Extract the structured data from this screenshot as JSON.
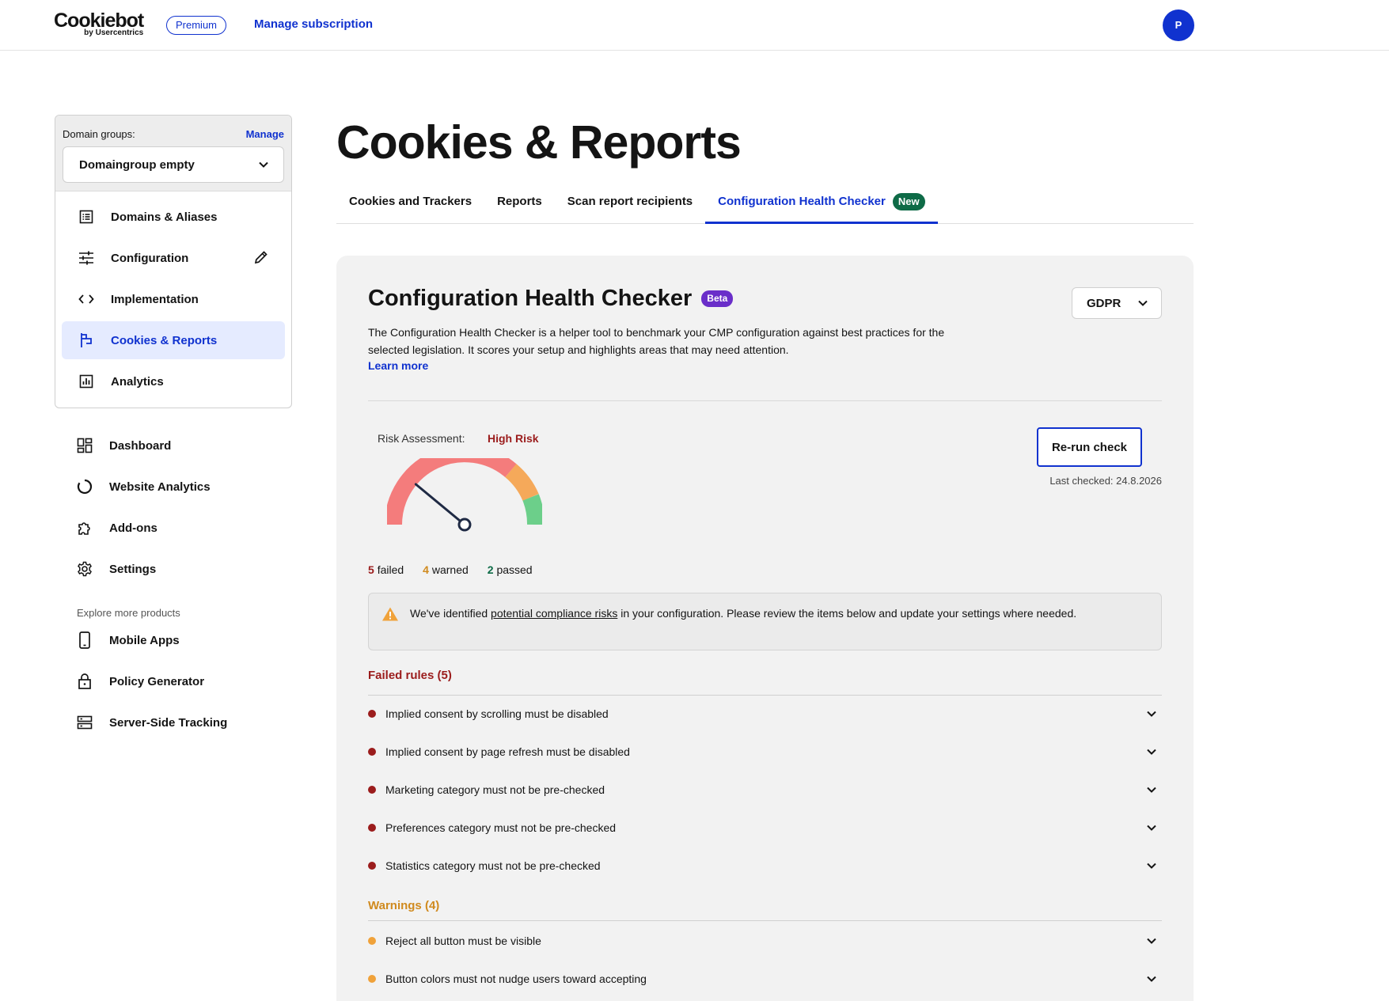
{
  "topbar": {
    "logo_main": "Cookiebot",
    "logo_sub": "by Usercentrics",
    "plan_badge": "Premium",
    "manage_subscription": "Manage subscription",
    "avatar_initial": "P"
  },
  "sidebar": {
    "domain_groups_label": "Domain groups:",
    "manage_label": "Manage",
    "domain_group_selected": "Domaingroup empty",
    "group_items": [
      {
        "label": "Domains & Aliases",
        "icon": "list-icon"
      },
      {
        "label": "Configuration",
        "icon": "sliders-icon"
      },
      {
        "label": "Implementation",
        "icon": "code-icon"
      },
      {
        "label": "Cookies & Reports",
        "icon": "flag-icon",
        "active": true
      },
      {
        "label": "Analytics",
        "icon": "chart-icon"
      }
    ],
    "main_items": [
      {
        "label": "Dashboard",
        "icon": "dashboard-icon"
      },
      {
        "label": "Website Analytics",
        "icon": "donut-icon"
      },
      {
        "label": "Add-ons",
        "icon": "puzzle-icon"
      },
      {
        "label": "Settings",
        "icon": "gear-icon"
      }
    ],
    "explore_label": "Explore more products",
    "explore_items": [
      {
        "label": "Mobile Apps",
        "icon": "phone-icon"
      },
      {
        "label": "Policy Generator",
        "icon": "lock-icon"
      },
      {
        "label": "Server-Side Tracking",
        "icon": "server-icon"
      }
    ]
  },
  "main": {
    "page_title": "Cookies & Reports",
    "tabs": [
      {
        "label": "Cookies and Trackers"
      },
      {
        "label": "Reports"
      },
      {
        "label": "Scan report recipients"
      },
      {
        "label": "Configuration Health Checker",
        "active": true,
        "badge": "New"
      }
    ]
  },
  "checker": {
    "title": "Configuration Health Checker",
    "beta_badge": "Beta",
    "legislation": "GDPR",
    "description": "The Configuration Health Checker is a helper tool to benchmark your CMP configuration against best practices for the selected legislation. It scores your setup and highlights areas that may need attention.",
    "learn_more": "Learn more",
    "risk_label": "Risk Assessment:",
    "risk_value": "High Risk",
    "risk_level": 0.22,
    "failed_count": "5",
    "failed_label": "failed",
    "warned_count": "4",
    "warned_label": "warned",
    "passed_count": "2",
    "passed_label": "passed",
    "rerun_label": "Re-run check",
    "last_checked": "Last checked: 24.8.2026",
    "alert_pre": "We've identified ",
    "alert_link": "potential compliance risks",
    "alert_post": " in your configuration. Please review the items below and update your settings where needed.",
    "failed_heading": "Failed rules (5)",
    "failed_rules": [
      "Implied consent by scrolling must be disabled",
      "Implied consent by page refresh must be disabled",
      "Marketing category must not be pre-checked",
      "Preferences category must not be pre-checked",
      "Statistics category must not be pre-checked"
    ],
    "warnings_heading": "Warnings (4)",
    "warning_rules": [
      "Reject all button must be visible",
      "Button colors must not nudge users toward accepting"
    ],
    "colors": {
      "accent": "#1032cf",
      "fail": "#9b1c1c",
      "warn": "#d08a1e",
      "pass": "#0e6b47"
    }
  }
}
